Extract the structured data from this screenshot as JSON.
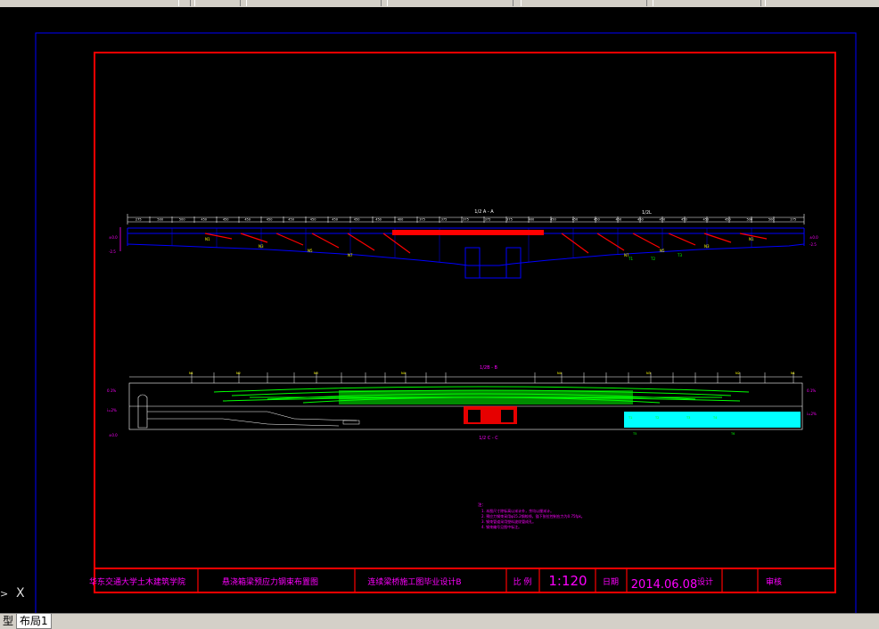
{
  "app": {
    "tabs": [
      {
        "label": "型"
      },
      {
        "label": "布局1"
      }
    ],
    "ucs": {
      "x_label": "X",
      "arrow": ">"
    }
  },
  "drawing": {
    "section_top_label": "1/2 A - A",
    "section_mid_label": "1/2B - B",
    "section_bottom_label": "1/2 C - C",
    "total_span": "1/2L",
    "dimensions_top": [
      "275",
      "500",
      "500",
      "450",
      "450",
      "450",
      "450",
      "450",
      "450",
      "450",
      "450",
      "450",
      "400",
      "375",
      "375",
      "375",
      "375",
      "375",
      "400",
      "450",
      "450",
      "450",
      "450",
      "450",
      "450",
      "450",
      "450",
      "450",
      "500",
      "500",
      "275"
    ],
    "notes_title": "注：",
    "notes": [
      "1. 本图尺寸除标高以米计外，余均以厘米计。",
      "2. 预应力钢束采用φ15.2钢绞线，锚下张拉控制应力为0.75fpk。",
      "3. 钢束管道采用塑料波纹管成孔。",
      "4. 钢束编号见图中标注。"
    ]
  },
  "title_block": {
    "school": "华东交通大学土木建筑学院",
    "drawing_name": "悬浇箱梁预应力钢束布置图",
    "project": "连续梁桥施工图毕业设计B",
    "scale_label": "比 例",
    "scale_value": "1:120",
    "date_label": "日期",
    "date_value": "2014.06.08",
    "designer_label": "设计",
    "checker_label": "审核"
  },
  "colors": {
    "frame_red": "#ff0000",
    "sheet_blue": "#0000ff",
    "green": "#00ff00",
    "magenta": "#ff00ff",
    "cyan": "#00ffff",
    "yellow": "#ffff00"
  }
}
